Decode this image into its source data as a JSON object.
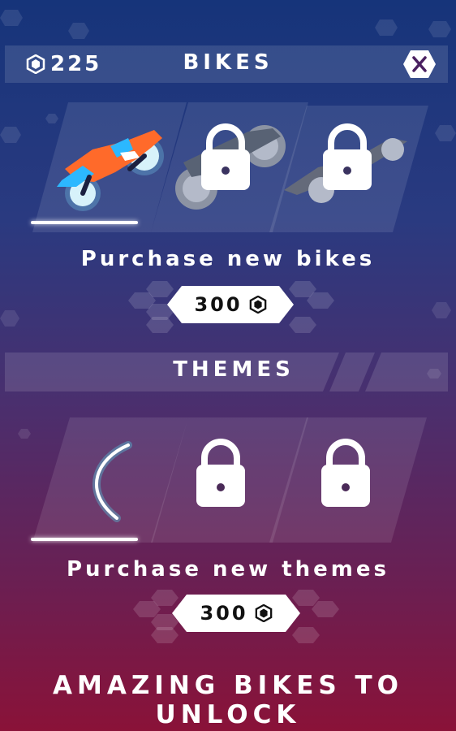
{
  "header": {
    "coin_count": "225",
    "title": "BIKES",
    "coin_icon": "hexagon-coin-icon",
    "close_icon": "close-icon"
  },
  "bikes": {
    "items": [
      {
        "name": "orange-bike",
        "locked": false,
        "selected": true
      },
      {
        "name": "gray-bike",
        "locked": true,
        "selected": false
      },
      {
        "name": "gray-sport-bike",
        "locked": true,
        "selected": false
      }
    ],
    "purchase_text": "Purchase new bikes",
    "price": "300"
  },
  "themes": {
    "title": "THEMES",
    "items": [
      {
        "name": "cyan-arc-theme",
        "locked": false,
        "selected": true
      },
      {
        "name": "locked-theme-2",
        "locked": true,
        "selected": false
      },
      {
        "name": "locked-theme-3",
        "locked": true,
        "selected": false
      }
    ],
    "purchase_text": "Purchase new themes",
    "price": "300"
  },
  "footer": {
    "text": "AMAZING BIKES TO UNLOCK"
  },
  "colors": {
    "bg_top": "#16347a",
    "bg_bottom": "#8a1238",
    "bike_orange": "#ff6a2a",
    "bike_blue": "#2cb8ff",
    "theme_cyan": "#4ff3ff"
  }
}
